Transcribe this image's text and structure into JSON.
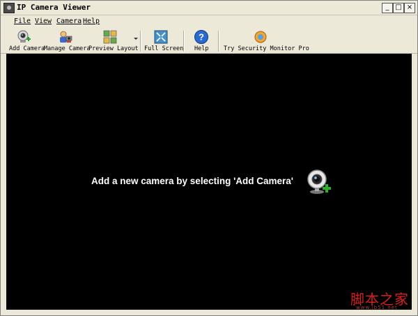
{
  "window": {
    "title": "IP Camera Viewer"
  },
  "window_controls": {
    "minimize": "_",
    "maximize": "□",
    "close": "×"
  },
  "menu": {
    "items": [
      "File",
      "View",
      "Camera",
      "Help"
    ]
  },
  "toolbar": {
    "add_camera": "Add Camera",
    "manage_camera": "Manage Camera",
    "preview_layout": "Preview Layout",
    "full_screen": "Full Screen",
    "help": "Help",
    "try_pro": "Try Security Monitor Pro"
  },
  "viewport": {
    "message": "Add a new camera by selecting 'Add Camera'"
  },
  "watermark": {
    "text": "脚本之家",
    "url": "www.jb51.net"
  },
  "colors": {
    "viewport_bg": "#000000",
    "chrome_bg": "#ece9d8",
    "watermark": "#d82020"
  }
}
